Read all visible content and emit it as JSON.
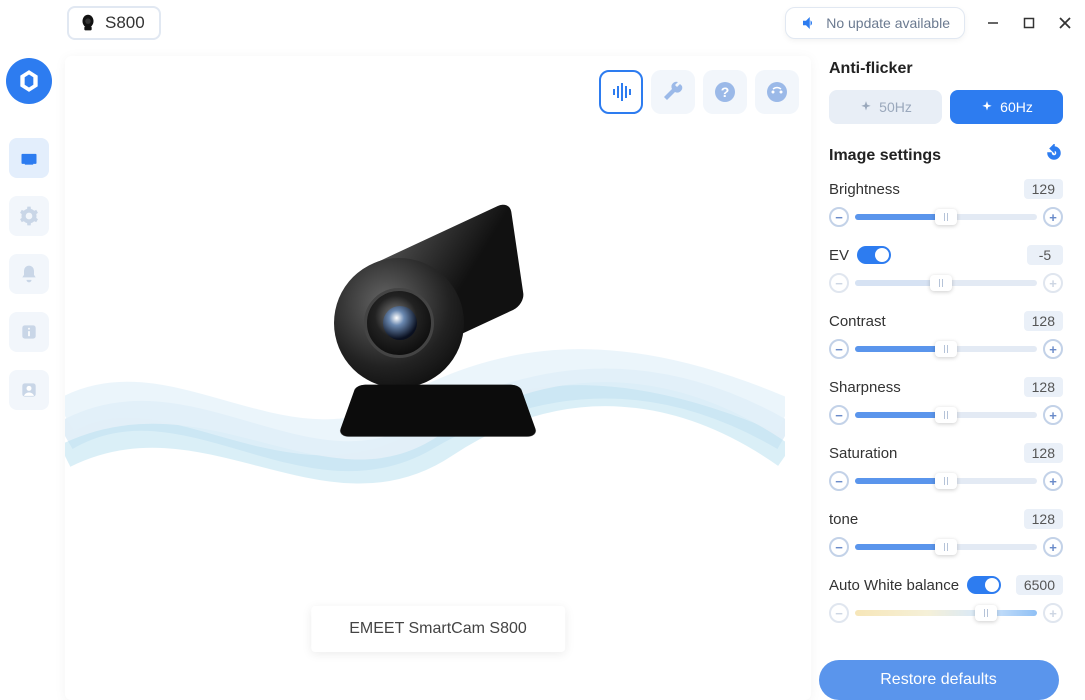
{
  "device": {
    "name": "S800"
  },
  "update": {
    "text": "No update available"
  },
  "preview": {
    "product_label": "EMEET SmartCam S800"
  },
  "anti_flicker": {
    "title": "Anti-flicker",
    "options": [
      "50Hz",
      "60Hz"
    ],
    "active": "60Hz"
  },
  "image_settings": {
    "title": "Image settings",
    "brightness": {
      "label": "Brightness",
      "value": "129",
      "pct": 50
    },
    "ev": {
      "label": "EV",
      "toggled": true,
      "value": "-5",
      "pct": 47
    },
    "contrast": {
      "label": "Contrast",
      "value": "128",
      "pct": 50
    },
    "sharpness": {
      "label": "Sharpness",
      "value": "128",
      "pct": 50
    },
    "saturation": {
      "label": "Saturation",
      "value": "128",
      "pct": 50
    },
    "tone": {
      "label": "tone",
      "value": "128",
      "pct": 50
    },
    "awb": {
      "label": "Auto White balance",
      "toggled": true,
      "value": "6500",
      "pct": 72
    }
  },
  "restore": {
    "label": "Restore defaults"
  }
}
